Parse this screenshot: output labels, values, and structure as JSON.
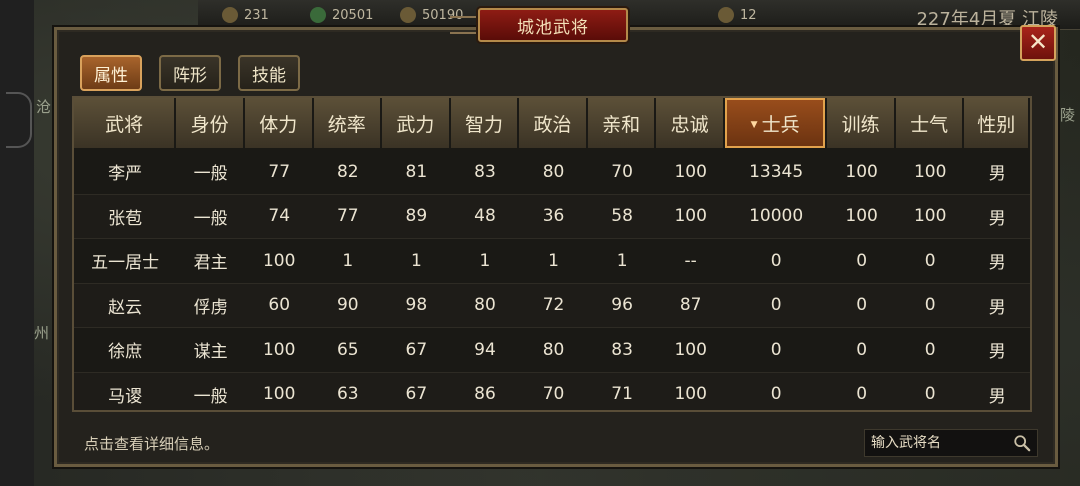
{
  "map": {
    "labels": [
      "沧",
      "陵",
      "州"
    ]
  },
  "topbar": {
    "resources": [
      {
        "icon": "food-icon",
        "value": "231"
      },
      {
        "icon": "wood-icon",
        "value": "20501"
      },
      {
        "icon": "gold-icon",
        "value": "50190"
      },
      {
        "icon": "troop-icon",
        "value": "12"
      }
    ],
    "date": "227年4月夏 江陵"
  },
  "panel": {
    "title": "城池武将",
    "close_label": "✕",
    "tabs": [
      {
        "label": "属性",
        "active": true
      },
      {
        "label": "阵形",
        "active": false
      },
      {
        "label": "技能",
        "active": false
      }
    ],
    "headers": [
      "武将",
      "身份",
      "体力",
      "统率",
      "武力",
      "智力",
      "政治",
      "亲和",
      "忠诚",
      "士兵",
      "训练",
      "士气",
      "性别"
    ],
    "sorted_column": "士兵",
    "rows": [
      [
        "李严",
        "一般",
        "77",
        "82",
        "81",
        "83",
        "80",
        "70",
        "100",
        "13345",
        "100",
        "100",
        "男"
      ],
      [
        "张苞",
        "一般",
        "74",
        "77",
        "89",
        "48",
        "36",
        "58",
        "100",
        "10000",
        "100",
        "100",
        "男"
      ],
      [
        "五一居士",
        "君主",
        "100",
        "1",
        "1",
        "1",
        "1",
        "1",
        "--",
        "0",
        "0",
        "0",
        "男"
      ],
      [
        "赵云",
        "俘虏",
        "60",
        "90",
        "98",
        "80",
        "72",
        "96",
        "87",
        "0",
        "0",
        "0",
        "男"
      ],
      [
        "徐庶",
        "谋主",
        "100",
        "65",
        "67",
        "94",
        "80",
        "83",
        "100",
        "0",
        "0",
        "0",
        "男"
      ],
      [
        "马谡",
        "一般",
        "100",
        "63",
        "67",
        "86",
        "70",
        "71",
        "100",
        "0",
        "0",
        "0",
        "男"
      ]
    ],
    "hint": "点击查看详细信息。",
    "search_placeholder": "输入武将名"
  }
}
